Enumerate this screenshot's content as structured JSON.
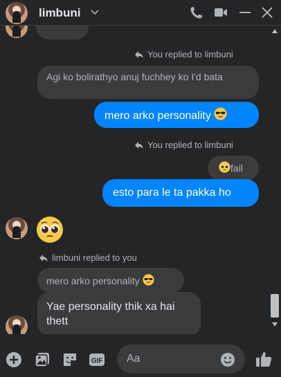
{
  "header": {
    "contact_name": "limbuni"
  },
  "messages": {
    "reply_note_1": "You replied to limbuni",
    "quoted_1": "Agi ko bolirathyo anuj fuchhey ko I'd bata",
    "outgoing_1": "mero arko personality",
    "reply_note_2": "You replied to limbuni",
    "quoted_2": "fail",
    "outgoing_2": "esto para le ta pakka ho",
    "reply_note_3": "limbuni replied to you",
    "quoted_3": "mero arko personality",
    "incoming_last": "Yae personality thik xa hai thett"
  },
  "composer": {
    "placeholder": "Aa"
  },
  "colors": {
    "background": "#242526",
    "bubble_incoming": "#3a3b3c",
    "bubble_outgoing": "#0084ff",
    "muted_text": "#b0b3b8"
  }
}
